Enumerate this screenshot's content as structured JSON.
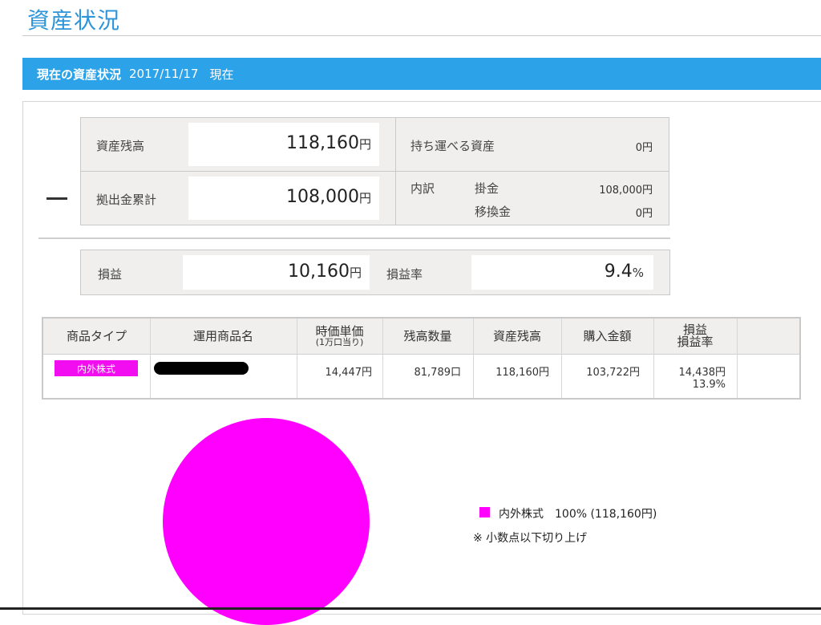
{
  "page": {
    "title": "資産状況"
  },
  "header": {
    "title": "現在の資産状況",
    "date": "2017/11/17",
    "suffix": "現在"
  },
  "summary": {
    "balance_label": "資産残高",
    "balance_value": "118,160",
    "balance_unit": "円",
    "portable_label": "持ち運べる資産",
    "portable_value": "0円",
    "contrib_label": "拠出金累計",
    "contrib_value": "108,000",
    "contrib_unit": "円",
    "breakdown_label": "内訳",
    "breakdown_items": [
      {
        "label": "掛金",
        "value": "108,000円"
      },
      {
        "label": "移換金",
        "value": "0円"
      }
    ],
    "operator": "—",
    "pl_label": "損益",
    "pl_value": "10,160",
    "pl_unit": "円",
    "pl_rate_label": "損益率",
    "pl_rate_value": "9.4",
    "pl_rate_unit": "%"
  },
  "table": {
    "headers": {
      "type": "商品タイプ",
      "name": "運用商品名",
      "price": "時価単価",
      "price_sub": "(1万口当り)",
      "qty": "残高数量",
      "balance": "資産残高",
      "purchase": "購入金額",
      "pl": "損益",
      "pl_rate": "損益率"
    },
    "rows": [
      {
        "type": "内外株式",
        "price": "14,447円",
        "qty": "81,789口",
        "balance": "118,160円",
        "purchase": "103,722円",
        "pl": "14,438円",
        "pl_rate": "13.9%"
      }
    ]
  },
  "chart_data": {
    "type": "pie",
    "slices": [
      {
        "name": "内外株式",
        "percent": 100,
        "value": 118160,
        "color": "#ff00ff"
      }
    ],
    "legend": [
      {
        "text": "内外株式　100% (118,160円)"
      }
    ],
    "note": "※ 小数点以下切り上げ"
  }
}
